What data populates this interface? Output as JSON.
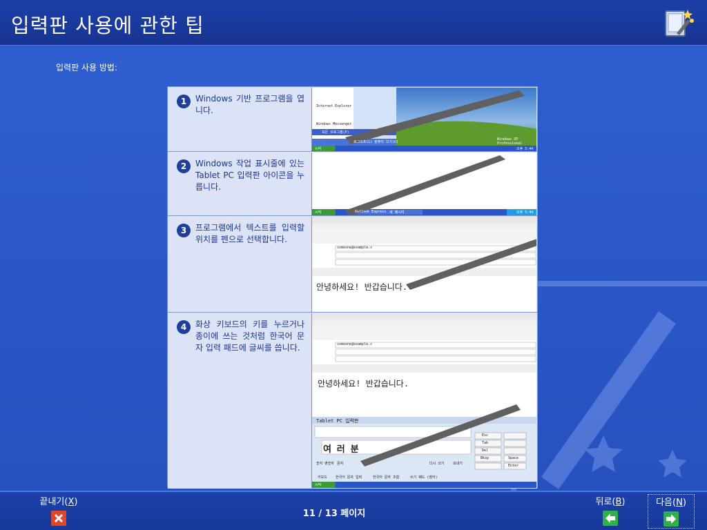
{
  "header": {
    "title": "입력판 사용에 관한 팁"
  },
  "subtitle": "입력판 사용 방법:",
  "steps": [
    {
      "number": "1",
      "text": "Windows 기반 프로그램을 엽니다."
    },
    {
      "number": "2",
      "text": "Windows 작업 표시줄에 있는 Tablet PC 입력판 아이콘을 누릅니다."
    },
    {
      "number": "3",
      "text": "프로그램에서 텍스트를 입력할 위치를 펜으로 선택합니다."
    },
    {
      "number": "4",
      "text": "화상 키보드의 키를 누르거나 종이에 쓰는 것처럼 한국어 문자 입력 패드에 글씨를 씁니다."
    }
  ],
  "screens": {
    "start_button": "시작",
    "step1_items": [
      "Internet Explorer",
      "Windows Messenger",
      "모든 프로그램(P)",
      "로그오프(L)",
      "컴퓨터 끄기(U)"
    ],
    "winxp_label": "Windows XP Professional",
    "clock": "오후 5:44",
    "task_outlook": "Outlook Express",
    "task_newmsg": "새 메시지",
    "email_to": "someone@example.c",
    "typed_text": "안녕하세요! 반갑습니다.",
    "pad_title": "Tablet PC 입력판",
    "pad_chars": "여 러 분",
    "pad_keys": [
      "Esc",
      "Tab",
      "Del",
      "Bksp",
      "Space",
      "Enter"
    ],
    "pad_buttons": [
      "숫자",
      "영숫자",
      "문자",
      "다시 쓰기",
      "보내기"
    ],
    "pad_tabs": [
      "키보드",
      "한국어 문자 입력",
      "한국어 문자 조합",
      "쓰기 패드 (영어)"
    ]
  },
  "footer": {
    "exit_label": "끝내기",
    "exit_key": "X",
    "back_label": "뒤로",
    "back_key": "B",
    "next_label": "다음",
    "next_key": "N",
    "page_indicator": "11 / 13 페이지"
  },
  "colors": {
    "header_bg": "#19399c",
    "body_bg": "#2a57c8",
    "step_text": "#1a3590",
    "exit_icon": "#e0462a",
    "nav_icon": "#2fb14a"
  }
}
